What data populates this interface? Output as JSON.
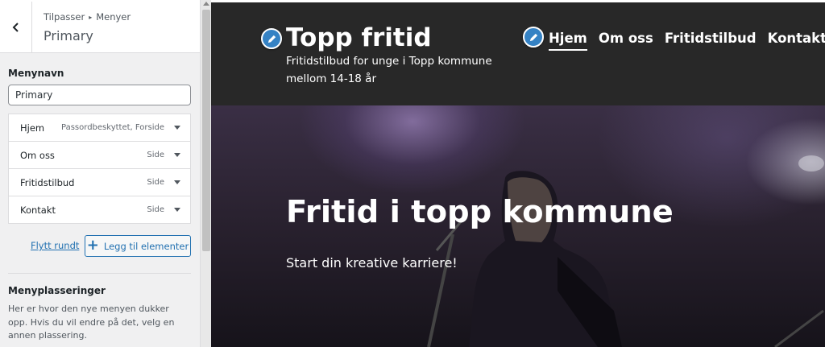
{
  "sidebar": {
    "breadcrumb": [
      "Tilpasser",
      "Menyer"
    ],
    "title": "Primary",
    "menu_name_label": "Menynavn",
    "menu_name_value": "Primary",
    "items": [
      {
        "label": "Hjem",
        "type": "Passordbeskyttet, Forside"
      },
      {
        "label": "Om oss",
        "type": "Side"
      },
      {
        "label": "Fritidstilbud",
        "type": "Side"
      },
      {
        "label": "Kontakt",
        "type": "Side"
      }
    ],
    "reorder_label": "Flytt rundt",
    "add_items_label": "Legg til elementer",
    "locations_title": "Menyplasseringer",
    "locations_desc": "Her er hvor den nye menyen dukker opp. Hvis du vil endre på det, velg en annen plassering."
  },
  "site": {
    "title": "Topp fritid",
    "description": "Fritidstilbud for unge i Topp kommune mellom 14-18 år",
    "nav": [
      "Hjem",
      "Om oss",
      "Fritidstilbud",
      "Kontakt"
    ],
    "active_nav": "Hjem",
    "hero_title": "Fritid i topp kommune",
    "hero_subtitle": "Start din kreative karriere!"
  },
  "colors": {
    "accent": "#2271b1",
    "edit_shortcut": "#3582c4",
    "header_bg": "#282828"
  },
  "icons": {
    "back": "chevron-left-icon",
    "edit": "pencil-icon",
    "add": "plus-icon",
    "expand": "caret-down-icon"
  }
}
